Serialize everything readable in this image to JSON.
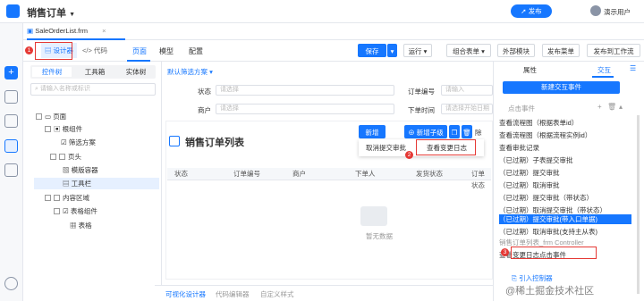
{
  "app": {
    "title": "销售订单",
    "publish": "发布",
    "user": "演示用户"
  },
  "file_tab": {
    "name": "SaleOrderList.frm",
    "close": "×"
  },
  "toolbar": {
    "designer": "设计器",
    "code": "代码",
    "tabs": [
      "页面",
      "模型",
      "配置"
    ],
    "save": "保存",
    "run": "运行",
    "combo_form": "组合表单",
    "external": "外部模块",
    "publish_menu": "发布菜单",
    "publish_flow": "发布到工作流"
  },
  "left_panel": {
    "tabs": [
      "控件树",
      "工具箱",
      "实体树"
    ],
    "search_placeholder": "请输入名称或标识",
    "tree": [
      "页面",
      "根组件",
      "筛选方案",
      "页头",
      "模版容器",
      "工具栏",
      "内容区域",
      "表格组件",
      "表格"
    ]
  },
  "filter": {
    "scheme": "默认筛选方案",
    "status_label": "状态",
    "status_placeholder": "请选择",
    "order_label": "订单编号",
    "order_placeholder": "请输入",
    "merchant_label": "商户",
    "merchant_placeholder": "请选择",
    "time_label": "下单时间",
    "time_placeholder": "请选择开始日期"
  },
  "list": {
    "title": "销售订单列表",
    "btn_new": "新增",
    "btn_new_child": "新增子级",
    "btn_delete": "除",
    "menu": [
      "取消提交审批",
      "查看变更日志"
    ],
    "columns": [
      "状态",
      "订单编号",
      "商户",
      "下单人",
      "发货状态",
      "订单状态"
    ],
    "empty": "暂无数据"
  },
  "bottom_tabs": [
    "可视化设计器",
    "代码编辑器",
    "自定义样式"
  ],
  "right_panel": {
    "tabs": [
      "属性",
      "交互"
    ],
    "new_event": "新建交互事件",
    "click_event": "点击事件",
    "events": [
      "查看流程图（根据表单id）",
      "查看流程图（根据流程实例id）",
      "查看审批记录",
      "（已过期）子表提交审批",
      "（已过期）提交审批",
      "（已过期）取消审批",
      "（已过期）提交审批（带状态）",
      "（已过期）取消提交审批（带状态）",
      "（已过期）提交审批(带入口单据)",
      "（已过期）取消审批(支持主从表)",
      "销售订单列表_frm Controller",
      "查看变更日志点击事件"
    ],
    "import_controller": "引入控制器"
  },
  "badges": [
    "1",
    "2",
    "3"
  ],
  "watermark": "@稀土掘金技术社区",
  "colors": {
    "primary": "#1677ff",
    "highlight": "#e53935"
  }
}
